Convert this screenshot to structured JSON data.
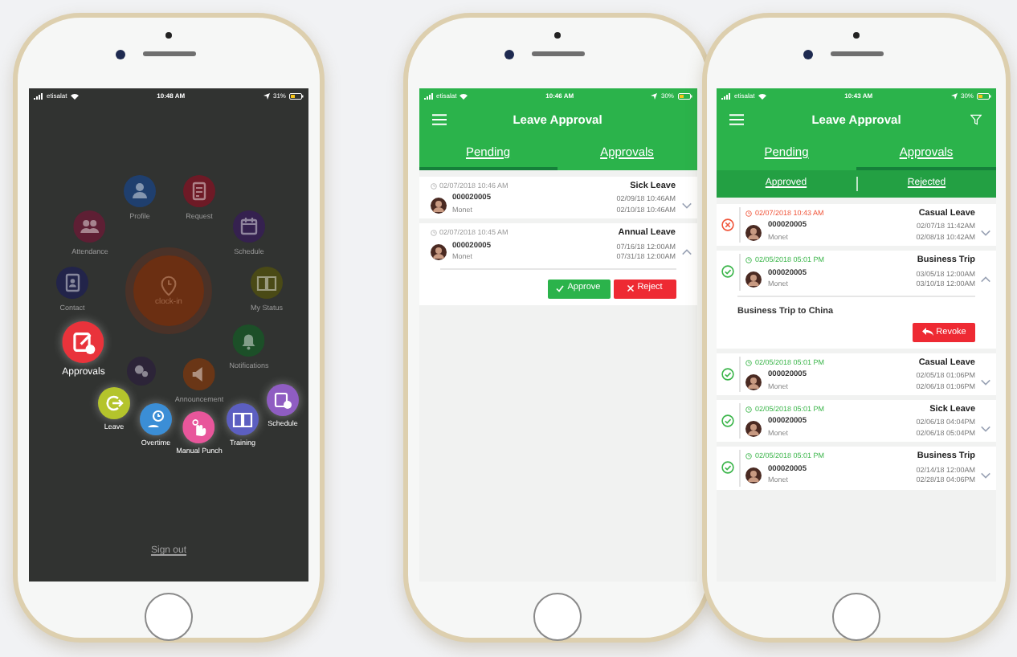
{
  "phones": [
    {
      "kind": "home",
      "status_bar": {
        "carrier": "etisalat",
        "time": "10:48 AM",
        "battery": "31%"
      },
      "center_button": "clock-in",
      "menu": [
        {
          "label": "Profile",
          "color": "#1f3f6e",
          "highlighted": false
        },
        {
          "label": "Request",
          "color": "#6e1a26",
          "highlighted": false
        },
        {
          "label": "Attendance",
          "color": "#5e1f34",
          "highlighted": false
        },
        {
          "label": "Schedule",
          "color": "#35214f",
          "highlighted": false
        },
        {
          "label": "Contact",
          "color": "#22244a",
          "highlighted": false
        },
        {
          "label": "My Status",
          "color": "#4a4a16",
          "highlighted": false
        },
        {
          "label": "Notifications",
          "color": "#1c4f28",
          "highlighted": false
        },
        {
          "label": "Announcement",
          "color": "#6a3616",
          "highlighted": false
        },
        {
          "color": "#2c2438",
          "highlighted": false
        },
        {
          "label": "Approvals",
          "color": "#e9333b",
          "highlighted": true
        },
        {
          "label": "Leave",
          "color": "#b4c42c",
          "highlighted": true
        },
        {
          "label": "Overtime",
          "color": "#3b8ed6",
          "highlighted": true
        },
        {
          "label": "Manual Punch",
          "color": "#e8569b",
          "highlighted": true
        },
        {
          "label": "Training",
          "color": "#5c5fc1",
          "highlighted": true
        },
        {
          "label": "Schedule",
          "color": "#8f5dc2",
          "highlighted": true
        }
      ],
      "sign_out": "Sign out"
    },
    {
      "kind": "approval",
      "status_bar": {
        "carrier": "etisalat",
        "time": "10:46 AM",
        "battery": "30%"
      },
      "title": "Leave Approval",
      "filter_button": false,
      "tabs": [
        {
          "label": "Pending",
          "selected": true
        },
        {
          "label": "Approvals",
          "selected": false
        }
      ],
      "requests": [
        {
          "kind": "pending",
          "submitted": "02/07/2018 10:46 AM",
          "id": "000020005",
          "name": "Monet",
          "leave_type": "Sick Leave",
          "from": "02/09/18 10:46AM",
          "to": "02/10/18 10:46AM",
          "expanded": false
        },
        {
          "kind": "pending",
          "submitted": "02/07/2018 10:45 AM",
          "id": "000020005",
          "name": "Monet",
          "leave_type": "Annual Leave",
          "from": "07/16/18 12:00AM",
          "to": "07/31/18 12:00AM",
          "expanded": true,
          "actions": [
            {
              "kind": "approve",
              "label": "Approve"
            },
            {
              "kind": "reject",
              "label": "Reject"
            }
          ]
        }
      ]
    },
    {
      "kind": "approval",
      "status_bar": {
        "carrier": "etisalat",
        "time": "10:43 AM",
        "battery": "30%"
      },
      "title": "Leave Approval",
      "filter_button": true,
      "tabs": [
        {
          "label": "Pending",
          "selected": false
        },
        {
          "label": "Approvals",
          "selected": true
        }
      ],
      "subtabs": [
        "Approved",
        "Rejected"
      ],
      "requests": [
        {
          "kind": "rejected",
          "submitted": "02/07/2018 10:43 AM",
          "id": "000020005",
          "name": "Monet",
          "leave_type": "Casual Leave",
          "from": "02/07/18 11:42AM",
          "to": "02/08/18 10:42AM",
          "expanded": false
        },
        {
          "kind": "approved",
          "submitted": "02/05/2018 05:01 PM",
          "id": "000020005",
          "name": "Monet",
          "leave_type": "Business Trip",
          "from": "03/05/18 12:00AM",
          "to": "03/10/18 12:00AM",
          "expanded": true,
          "comment": "Business Trip to China",
          "actions": [
            {
              "kind": "revoke",
              "label": "Revoke"
            }
          ]
        },
        {
          "kind": "approved",
          "submitted": "02/05/2018 05:01 PM",
          "id": "000020005",
          "name": "Monet",
          "leave_type": "Casual Leave",
          "from": "02/05/18 01:06PM",
          "to": "02/06/18 01:06PM",
          "expanded": false
        },
        {
          "kind": "approved",
          "submitted": "02/05/2018 05:01 PM",
          "id": "000020005",
          "name": "Monet",
          "leave_type": "Sick Leave",
          "from": "02/06/18 04:04PM",
          "to": "02/06/18 05:04PM",
          "expanded": false
        },
        {
          "kind": "approved",
          "submitted": "02/05/2018 05:01 PM",
          "id": "000020005",
          "name": "Monet",
          "leave_type": "Business Trip",
          "from": "02/14/18 12:00AM",
          "to": "02/28/18 04:06PM",
          "expanded": false
        }
      ]
    }
  ]
}
